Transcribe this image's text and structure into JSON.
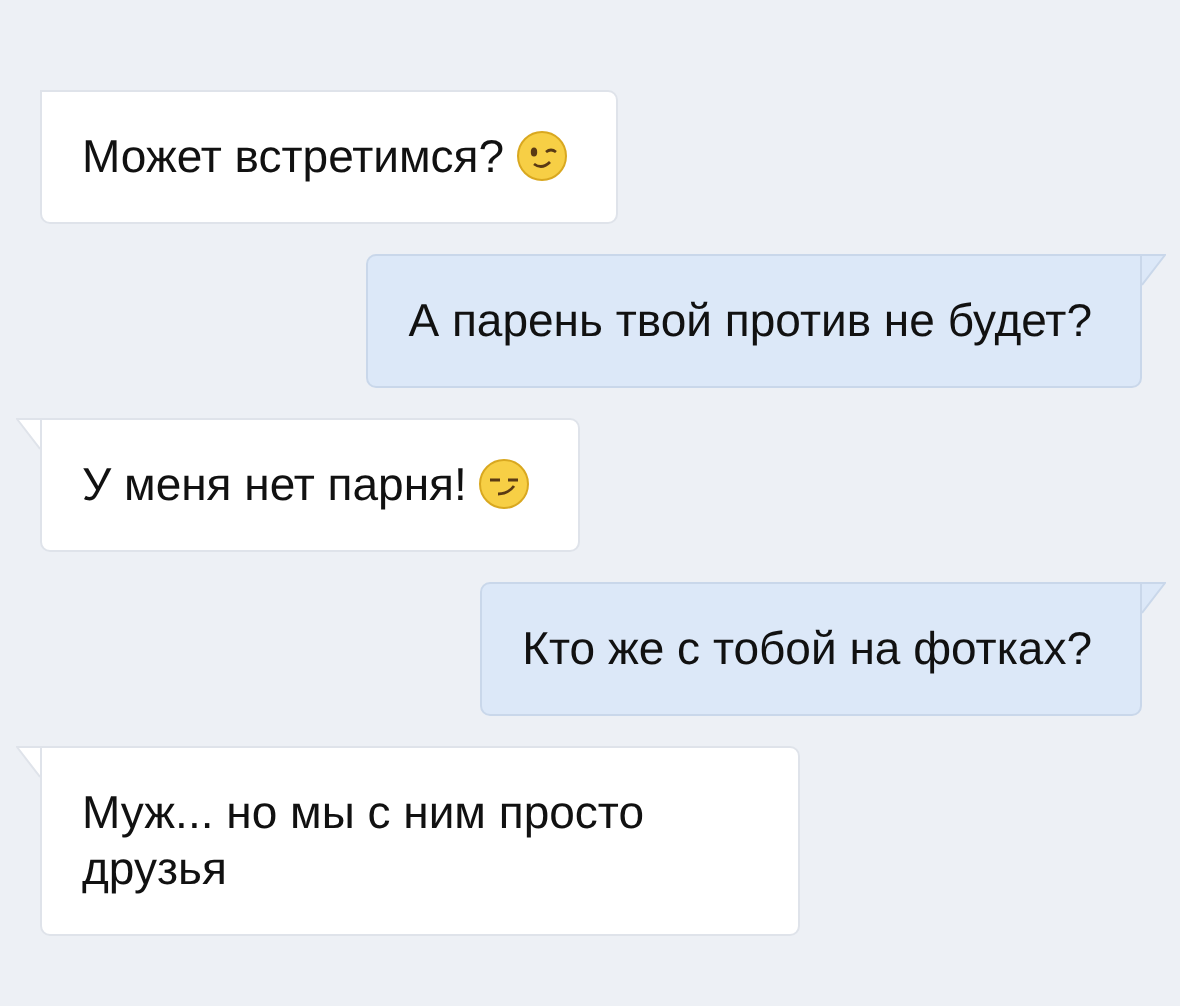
{
  "messages": [
    {
      "kind": "incoming",
      "text": "Может встретимся?",
      "emoji": {
        "kind": "wink"
      },
      "tail": false
    },
    {
      "kind": "outgoing",
      "text": "А парень твой против не будет?",
      "tail": true
    },
    {
      "kind": "incoming",
      "text": "У меня нет парня!",
      "emoji": {
        "kind": "smirk"
      },
      "tail": true
    },
    {
      "kind": "outgoing",
      "text": "Кто же с тобой на фотках?",
      "tail": true
    },
    {
      "kind": "incoming",
      "text": "Муж... но мы с ним просто друзья",
      "tail": true
    }
  ]
}
